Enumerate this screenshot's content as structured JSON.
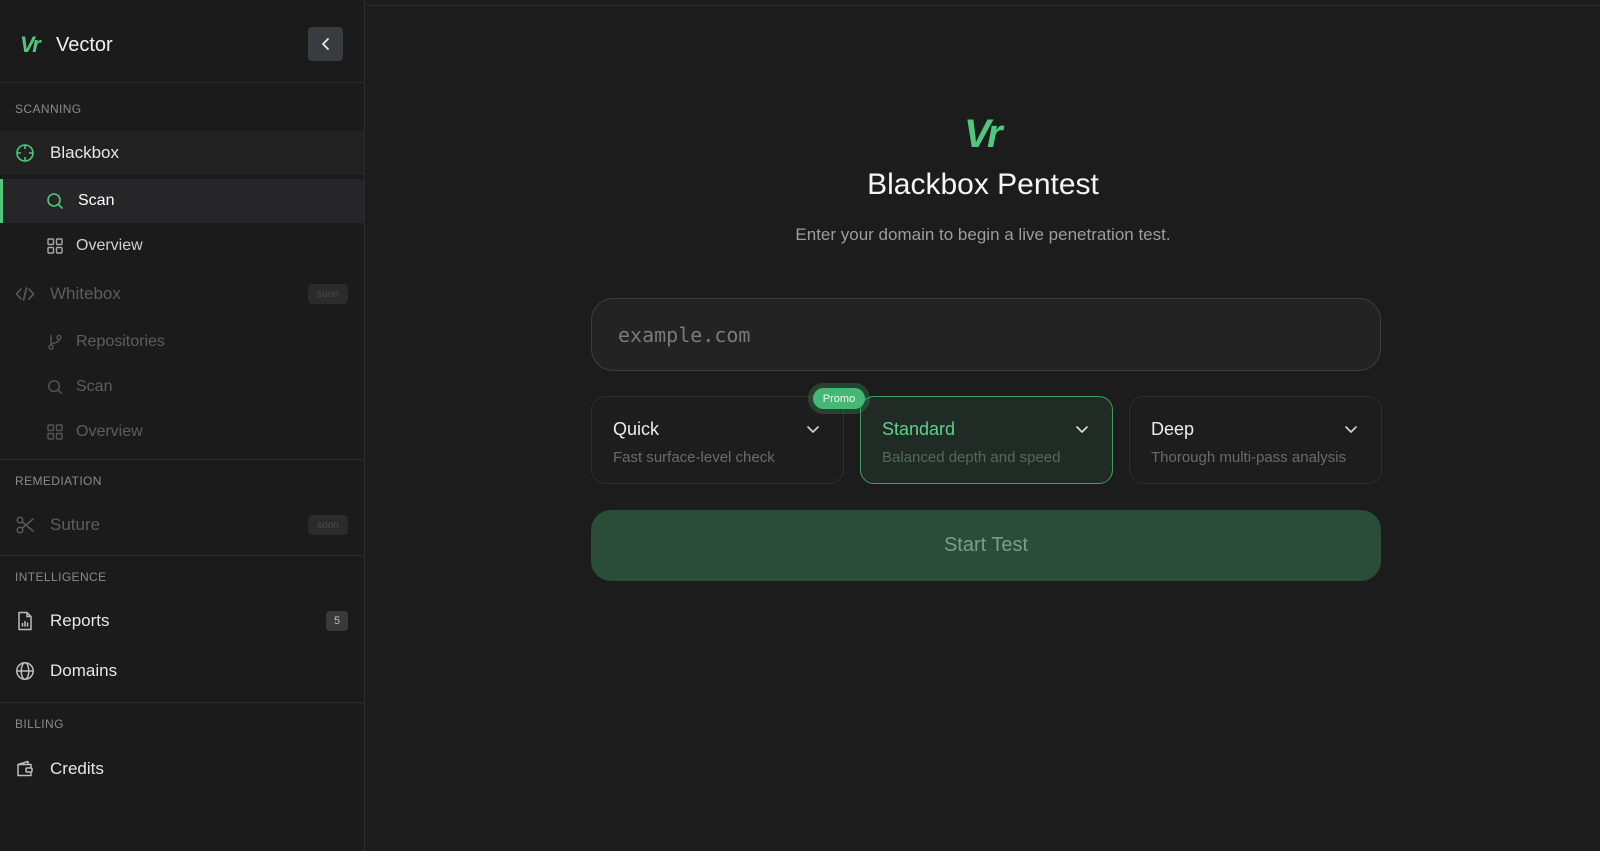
{
  "app": {
    "name": "Vector",
    "logo_text": "Vr"
  },
  "colors": {
    "accent": "#4fc77d",
    "background": "#1c1c1c",
    "sidebar": "#1b1b1b"
  },
  "sidebar": {
    "sections": {
      "scanning": "SCANNING",
      "remediation": "REMEDIATION",
      "intelligence": "INTELLIGENCE",
      "billing": "BILLING"
    },
    "blackbox": {
      "label": "Blackbox",
      "icon": "crosshair-icon"
    },
    "blackbox_scan": {
      "label": "Scan",
      "icon": "search-icon"
    },
    "blackbox_overview": {
      "label": "Overview",
      "icon": "grid-icon"
    },
    "whitebox": {
      "label": "Whitebox",
      "icon": "code-icon",
      "badge": "soon"
    },
    "repositories": {
      "label": "Repositories",
      "icon": "git-branch-icon"
    },
    "whitebox_scan": {
      "label": "Scan",
      "icon": "search-icon"
    },
    "whitebox_overview": {
      "label": "Overview",
      "icon": "grid-icon"
    },
    "suture": {
      "label": "Suture",
      "icon": "scissors-icon",
      "badge": "soon"
    },
    "reports": {
      "label": "Reports",
      "icon": "file-chart-icon",
      "count": "5"
    },
    "domains": {
      "label": "Domains",
      "icon": "globe-icon"
    },
    "credits": {
      "label": "Credits",
      "icon": "wallet-icon"
    }
  },
  "main": {
    "logo_text": "Vr",
    "title": "Blackbox Pentest",
    "subtitle": "Enter your domain to begin a live penetration test.",
    "domain_input": {
      "placeholder": "example.com",
      "value": ""
    },
    "modes": [
      {
        "title": "Quick",
        "desc": "Fast surface-level check"
      },
      {
        "title": "Standard",
        "desc": "Balanced depth and speed",
        "badge": "Promo",
        "selected": true
      },
      {
        "title": "Deep",
        "desc": "Thorough multi-pass analysis"
      }
    ],
    "start_label": "Start Test"
  }
}
